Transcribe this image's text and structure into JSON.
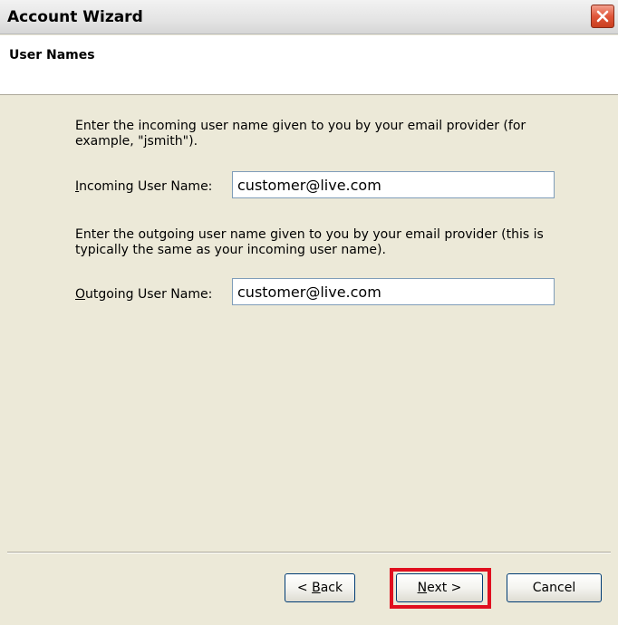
{
  "window": {
    "title": "Account Wizard"
  },
  "header": {
    "title": "User Names"
  },
  "incoming": {
    "description": "Enter the incoming user name given to you by your email provider (for example, \"jsmith\").",
    "label_prefix": "",
    "label_mnemonic": "I",
    "label_rest": "ncoming User Name:",
    "value": "customer@live.com"
  },
  "outgoing": {
    "description": "Enter the outgoing user name given to you by your email provider (this is typically the same as your incoming user name).",
    "label_mnemonic": "O",
    "label_rest": "utgoing User Name:",
    "value": "customer@live.com"
  },
  "buttons": {
    "back_prefix": "< ",
    "back_mnemonic": "B",
    "back_rest": "ack",
    "next_mnemonic": "N",
    "next_rest": "ext >",
    "cancel_label": "Cancel"
  },
  "colors": {
    "highlight": "#e0101f",
    "close_button": "#e0563a"
  }
}
